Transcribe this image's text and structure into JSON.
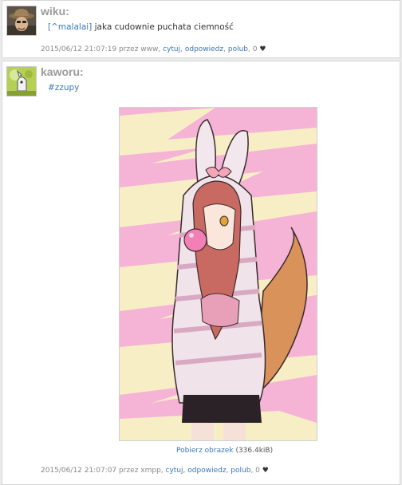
{
  "posts": [
    {
      "author": "wiku:",
      "mention": "[^malalai]",
      "text": " jaka cudownie puchata ciemność",
      "timestamp": "2015/06/12 21:07:19 przez www,",
      "actions": [
        "cytuj",
        "odpowiedz",
        "polub"
      ],
      "likes": "0",
      "heart": "♥"
    },
    {
      "author": "kaworu:",
      "tag": "#zzupy",
      "download_link": "Pobierz obrazek",
      "download_size": "(336.4kiB)",
      "timestamp": "2015/06/12 21:07:07 przez xmpp,",
      "actions": [
        "cytuj",
        "odpowiedz",
        "polub"
      ],
      "likes": "0",
      "heart": "♥"
    }
  ],
  "colors": {
    "link": "#3b78b8",
    "author": "#9a9a9a",
    "image_bg": "#f6b9d9",
    "image_stripe": "#f8eec6"
  },
  "icons": {
    "avatar1": "cowboy-hat-avatar-icon",
    "avatar2": "cartoon-creature-avatar-icon",
    "heart": "heart-icon"
  }
}
